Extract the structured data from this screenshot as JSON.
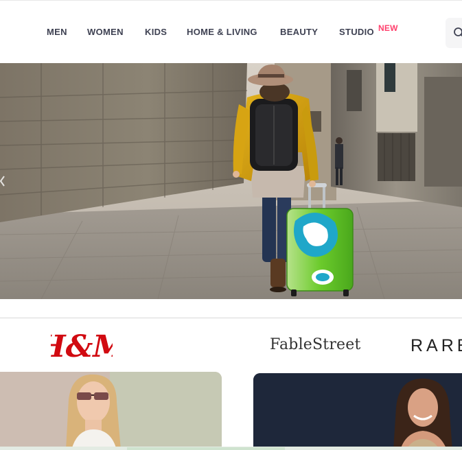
{
  "nav": {
    "items": [
      {
        "label": "MEN"
      },
      {
        "label": "WOMEN"
      },
      {
        "label": "KIDS"
      },
      {
        "label": "HOME & LIVING"
      },
      {
        "label": "BEAUTY"
      },
      {
        "label": "STUDIO"
      }
    ],
    "studio_badge": "NEW"
  },
  "search": {
    "icon": "search-icon"
  },
  "hero": {
    "description": "banner-image",
    "carousel_arrow_icon": "chevron-left-icon"
  },
  "brands": [
    {
      "label": "H&M",
      "style": "logo"
    },
    {
      "label": "FableStreet"
    },
    {
      "label": "RARE"
    }
  ],
  "colors": {
    "accent": "#ff3f6c",
    "nav_text": "#3e4152",
    "hm_red": "#d10a11"
  }
}
